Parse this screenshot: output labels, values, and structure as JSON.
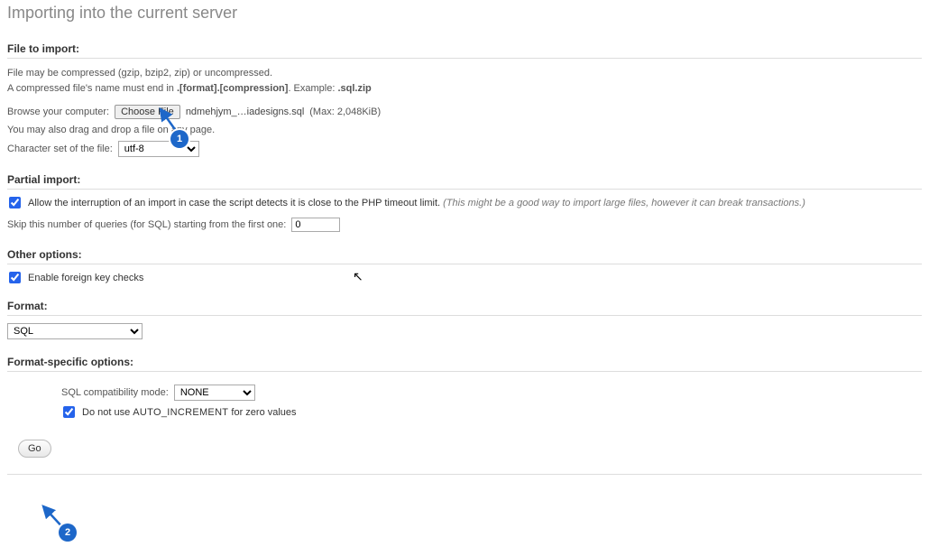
{
  "title": "Importing into the current server",
  "file": {
    "legend": "File to import:",
    "note1": "File may be compressed (gzip, bzip2, zip) or uncompressed.",
    "note2a": "A compressed file's name must end in ",
    "note2b": ".[format].[compression]",
    "note2c": ". Example: ",
    "note2d": ".sql.zip",
    "browse_label": "Browse your computer:",
    "choose_btn": "Choose File",
    "filename": "ndmehjym_…iadesigns.sql",
    "maxsize": "(Max: 2,048KiB)",
    "dragdrop": "You may also drag and drop a file on any page.",
    "charset_label": "Character set of the file:",
    "charset_value": "utf-8"
  },
  "partial": {
    "legend": "Partial import:",
    "allow_label": "Allow the interruption of an import in case the script detects it is close to the PHP timeout limit. ",
    "allow_hint": "(This might be a good way to import large files, however it can break transactions.)",
    "skip_label": "Skip this number of queries (for SQL) starting from the first one:",
    "skip_value": "0"
  },
  "other": {
    "legend": "Other options:",
    "fk_label": "Enable foreign key checks"
  },
  "format": {
    "legend": "Format:",
    "value": "SQL"
  },
  "format_opts": {
    "legend": "Format-specific options:",
    "compat_label": "SQL compatibility mode:",
    "compat_value": "NONE",
    "noauto_a": "Do not use ",
    "noauto_b": "AUTO_INCREMENT",
    "noauto_c": " for zero values"
  },
  "go_label": "Go",
  "markers": {
    "m1": "1",
    "m2": "2"
  }
}
